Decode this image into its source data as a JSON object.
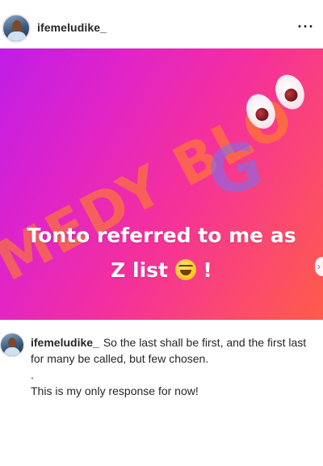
{
  "post": {
    "username": "ifemeludike_",
    "more_icon": "···",
    "story_text_line1": "Tonto referred to me as",
    "story_text_line2": "Z list",
    "story_text_after_emoji": "!",
    "watermark": "MEDY BLO",
    "watermark_g": "G"
  },
  "caption": {
    "username": "ifemeludike_",
    "line1": "So the last shall be first, and the first last",
    "line2": "for many be called, but few chosen.",
    "line3": ".",
    "line4": "This is my only response for now!"
  },
  "colors": {
    "gradient_start": "#c01de6",
    "gradient_mid": "#f5309b",
    "gradient_end": "#ff5b48",
    "text": "#262626"
  },
  "icons": [
    "more-options-icon",
    "eyes-emoji-icon",
    "laughing-emoji-icon",
    "next-arrow-icon"
  ]
}
